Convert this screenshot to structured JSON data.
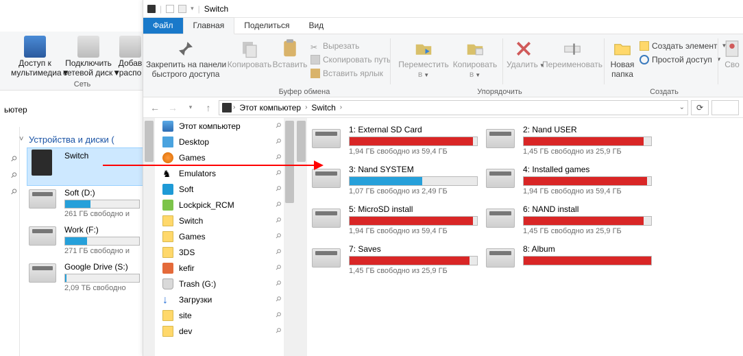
{
  "bg": {
    "addr_suffix": "ьютер",
    "ribbon": {
      "media_access": "Доступ к\nмультимедиа",
      "net_drive": "Подключить\nсетевой диск",
      "add_loc": "Добав\nраспо",
      "group_network": "Сеть"
    },
    "section_header": "Устройства и диски (",
    "drives": [
      {
        "name": "Switch",
        "selected": true,
        "special": "switch"
      },
      {
        "name": "Soft (D:)",
        "bar_pct": 34,
        "bar_color": "#26a0da",
        "info": "261 ГБ свободно и"
      },
      {
        "name": "Work (F:)",
        "bar_pct": 30,
        "bar_color": "#26a0da",
        "info": "271 ГБ свободно и"
      },
      {
        "name": "Google Drive (S:)",
        "bar_pct": 2,
        "bar_color": "#26a0da",
        "info": "2,09 ТБ свободно"
      }
    ]
  },
  "fg": {
    "title": "Switch",
    "tabs": {
      "file": "Файл",
      "home": "Главная",
      "share": "Поделиться",
      "view": "Вид"
    },
    "ribbon": {
      "pin": "Закрепить на панели\nбыстрого доступа",
      "copy": "Копировать",
      "paste": "Вставить",
      "cut": "Вырезать",
      "copy_path": "Скопировать путь",
      "paste_shortcut": "Вставить ярлык",
      "group_clipboard": "Буфер обмена",
      "move_to": "Переместить\nв",
      "copy_to": "Копировать\nв",
      "delete": "Удалить",
      "rename": "Переименовать",
      "group_organize": "Упорядочить",
      "new_folder": "Новая\nпапка",
      "new_item": "Создать элемент",
      "easy_access": "Простой доступ",
      "group_new": "Создать",
      "properties": "Сво"
    },
    "breadcrumb": {
      "root": "Этот компьютер",
      "leaf": "Switch"
    },
    "sidebar": [
      {
        "label": "Этот компьютер",
        "icon": "i-pc",
        "pinned": true
      },
      {
        "label": "Desktop",
        "icon": "i-desktop",
        "pinned": true
      },
      {
        "label": "Games",
        "icon": "i-game",
        "pinned": true
      },
      {
        "label": "Emulators",
        "icon": "i-emul",
        "pinned": true
      },
      {
        "label": "Soft",
        "icon": "i-soft",
        "pinned": true
      },
      {
        "label": "Lockpick_RCM",
        "icon": "i-lock",
        "pinned": true
      },
      {
        "label": "Switch",
        "icon": "i-folder",
        "pinned": true
      },
      {
        "label": "Games",
        "icon": "i-folder",
        "pinned": true
      },
      {
        "label": "3DS",
        "icon": "i-folder",
        "pinned": true
      },
      {
        "label": "kefir",
        "icon": "i-kefir",
        "pinned": true
      },
      {
        "label": "Trash (G:)",
        "icon": "i-trash",
        "pinned": true
      },
      {
        "label": "Загрузки",
        "icon": "i-dl",
        "pinned": true
      },
      {
        "label": "site",
        "icon": "i-folder",
        "pinned": true
      },
      {
        "label": "dev",
        "icon": "i-folder",
        "pinned": true
      }
    ],
    "drives": [
      {
        "name": "1: External SD Card",
        "bar_pct": 97,
        "bar_color": "#d92626",
        "info": "1,94 ГБ свободно из 59,4 ГБ"
      },
      {
        "name": "2: Nand USER",
        "bar_pct": 94,
        "bar_color": "#d92626",
        "info": "1,45 ГБ свободно из 25,9 ГБ"
      },
      {
        "name": "3: Nand SYSTEM",
        "bar_pct": 57,
        "bar_color": "#26a0da",
        "info": "1,07 ГБ свободно из 2,49 ГБ"
      },
      {
        "name": "4: Installed games",
        "bar_pct": 97,
        "bar_color": "#d92626",
        "info": "1,94 ГБ свободно из 59,4 ГБ"
      },
      {
        "name": "5: MicroSD install",
        "bar_pct": 97,
        "bar_color": "#d92626",
        "info": "1,94 ГБ свободно из 59,4 ГБ"
      },
      {
        "name": "6: NAND install",
        "bar_pct": 94,
        "bar_color": "#d92626",
        "info": "1,45 ГБ свободно из 25,9 ГБ"
      },
      {
        "name": "7: Saves",
        "bar_pct": 94,
        "bar_color": "#d92626",
        "info": "1,45 ГБ свободно из 25,9 ГБ"
      },
      {
        "name": "8: Album",
        "bar_pct": 100,
        "bar_color": "#d92626",
        "info": ""
      }
    ]
  }
}
